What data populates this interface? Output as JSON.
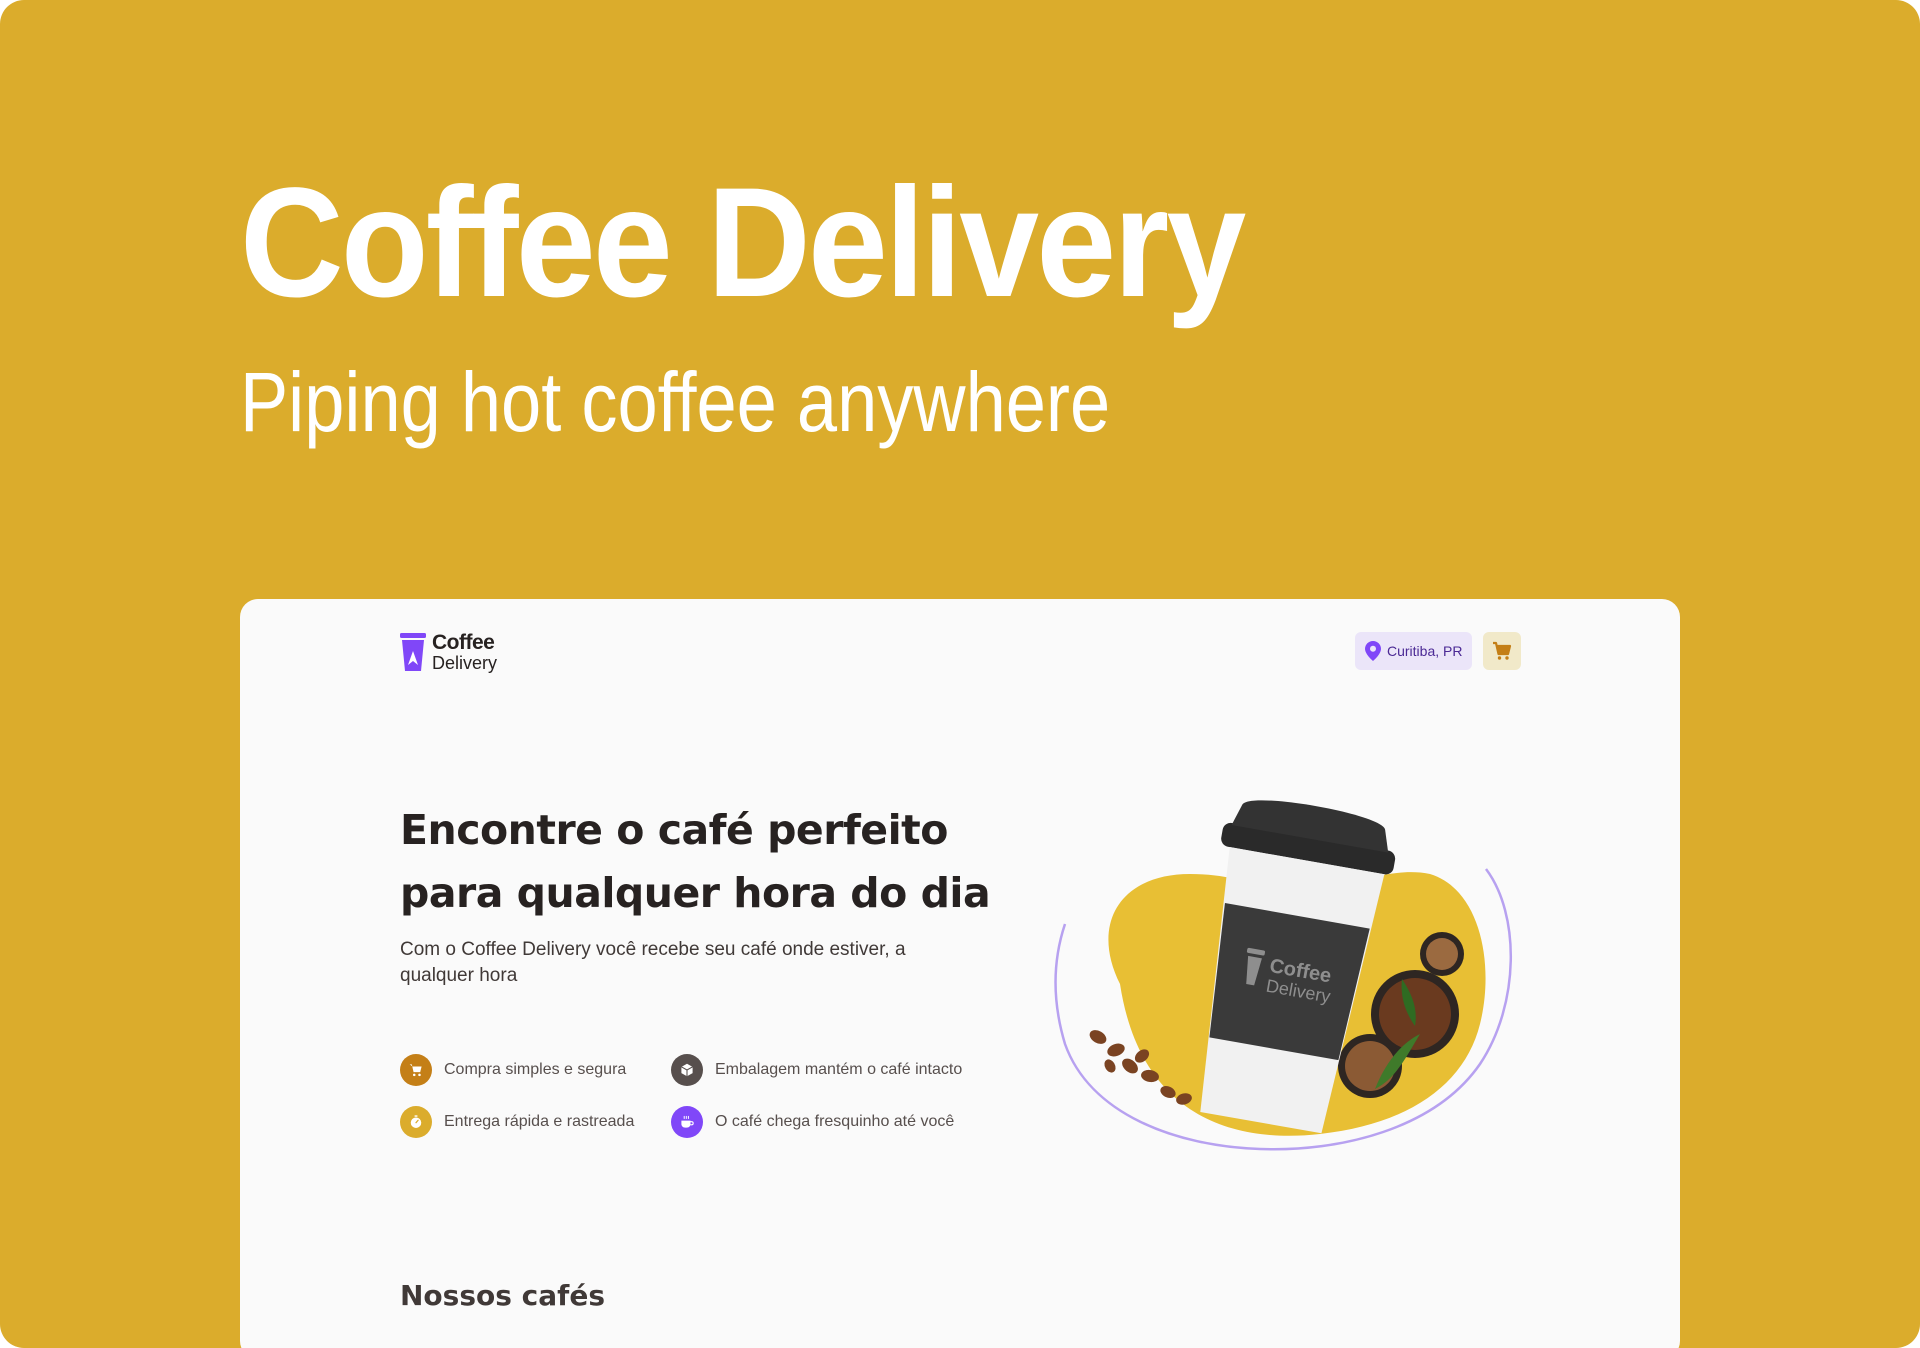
{
  "banner": {
    "title": "Coffee Delivery",
    "subtitle": "Piping hot coffee anywhere"
  },
  "colors": {
    "banner_bg": "#DBAC2C",
    "purple": "#8047F8",
    "purple_dark": "#4B2995",
    "yellow": "#DBAC2C",
    "yellow_dark": "#C47F17",
    "base_text": "#574F4D",
    "title": "#272221"
  },
  "header": {
    "logo_line1": "Coffee",
    "logo_line2": "Delivery",
    "location": "Curitiba, PR",
    "location_icon": "map-pin-icon",
    "cart_icon": "shopping-cart-icon"
  },
  "intro": {
    "title": "Encontre o café perfeito para qualquer hora do dia",
    "description": "Com o Coffee Delivery você recebe seu café onde estiver, a qualquer hora",
    "features": [
      {
        "label": "Compra simples e segura",
        "icon": "shopping-cart-icon",
        "color": "#C47F17"
      },
      {
        "label": "Embalagem mantém o café intacto",
        "icon": "package-icon",
        "color": "#574F4D"
      },
      {
        "label": "Entrega rápida e rastreada",
        "icon": "timer-icon",
        "color": "#DBAC2C"
      },
      {
        "label": "O café chega fresquinho até você",
        "icon": "coffee-icon",
        "color": "#8047F8"
      }
    ],
    "cup_logo_line1": "Coffee",
    "cup_logo_line2": "Delivery"
  },
  "section": {
    "title": "Nossos cafés"
  }
}
